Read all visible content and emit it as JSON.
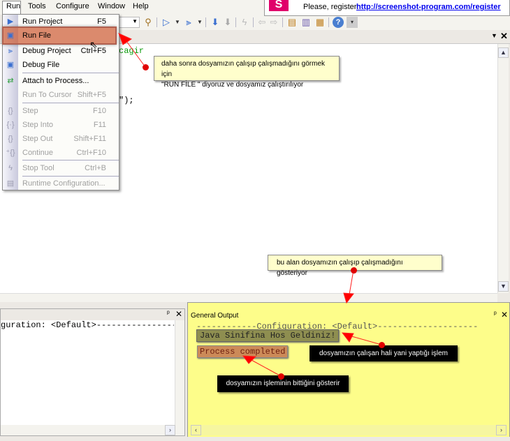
{
  "menubar": {
    "items": [
      "Run",
      "Tools",
      "Configure",
      "Window",
      "Help"
    ]
  },
  "register": {
    "text": "Please, register:",
    "link": "http://screenshot-program.com/register",
    "logo": "S"
  },
  "run_menu": {
    "items": [
      {
        "label": "Run Project",
        "shortcut": "F5",
        "icon": "run-project-icon",
        "enabled": true
      },
      {
        "label": "Run File",
        "shortcut": "",
        "icon": "run-file-icon",
        "enabled": true
      },
      {
        "label": "Debug Project",
        "shortcut": "Ctrl+F5",
        "icon": "debug-project-icon",
        "enabled": true
      },
      {
        "label": "Debug File",
        "shortcut": "",
        "icon": "debug-file-icon",
        "enabled": true
      },
      {
        "label": "Attach to Process...",
        "shortcut": "",
        "icon": "attach-icon",
        "enabled": true
      },
      {
        "label": "Run To Cursor",
        "shortcut": "Shift+F5",
        "enabled": false
      },
      {
        "label": "Step",
        "shortcut": "F10",
        "icon": "step-icon",
        "enabled": false
      },
      {
        "label": "Step Into",
        "shortcut": "F11",
        "icon": "step-into-icon",
        "enabled": false
      },
      {
        "label": "Step Out",
        "shortcut": "Shift+F11",
        "icon": "step-out-icon",
        "enabled": false
      },
      {
        "label": "Continue",
        "shortcut": "Ctrl+F10",
        "icon": "continue-icon",
        "enabled": false
      },
      {
        "label": "Stop Tool",
        "shortcut": "Ctrl+B",
        "icon": "stop-tool-icon",
        "enabled": false
      },
      {
        "label": "Runtime Configuration...",
        "shortcut": "",
        "icon": "runtime-config-icon",
        "enabled": false
      }
    ]
  },
  "editor": {
    "code_fragment_1": "cagir",
    "code_fragment_2": "\");"
  },
  "annotations": {
    "run_file": "daha sonra dosyamızın çalışıp çalışmadığını görmek için\n\"RUN FİLE \" diyoruz ve dosyamız çalıştırılıyor",
    "output_area": "bu alan dosyamızın çalışıp çalışmadığını gösteriyor",
    "running": "dosyamızın çalışan hali yani  yaptığı işlem",
    "finished": "dosyamızın işleminin bittiğini gösterir"
  },
  "left_panel": {
    "line": "guration: <Default>-----------------"
  },
  "output": {
    "title": "General Output",
    "header_line": "------------Configuration: <Default>--------------------",
    "lines": [
      "Java Sinifina Hos Geldiniz!",
      "Process completed"
    ]
  },
  "colors": {
    "highlight": "#cd5a32",
    "output_bg": "#fdfd8a",
    "annotation_arrow": "#e00000"
  }
}
